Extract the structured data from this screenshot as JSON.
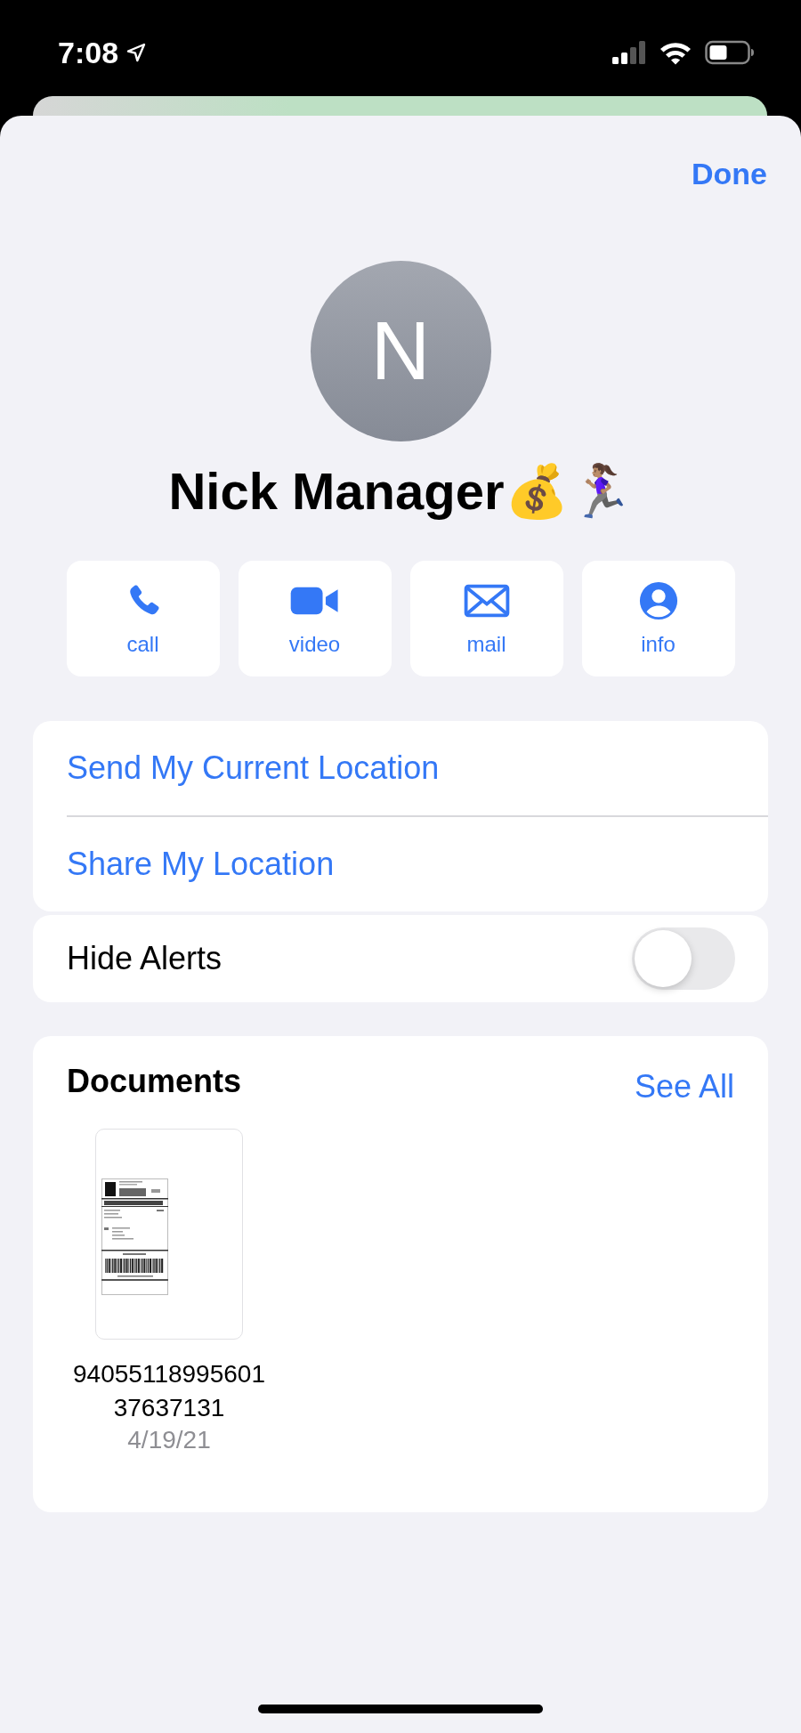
{
  "status_bar": {
    "time": "7:08"
  },
  "done": "Done",
  "contact": {
    "initial": "N",
    "name": "Nick Manager💰🏃🏽‍♀️"
  },
  "actions": [
    {
      "kind": "phone",
      "label": "call"
    },
    {
      "kind": "video",
      "label": "video"
    },
    {
      "kind": "mail",
      "label": "mail"
    },
    {
      "kind": "info",
      "label": "info"
    }
  ],
  "location_options": [
    "Send My Current Location",
    "Share My Location"
  ],
  "hide_alerts": {
    "label": "Hide Alerts",
    "on": false
  },
  "documents": {
    "title": "Documents",
    "see_all": "See All",
    "items": [
      {
        "name": "9405511899560137637131",
        "date": "4/19/21"
      }
    ]
  }
}
